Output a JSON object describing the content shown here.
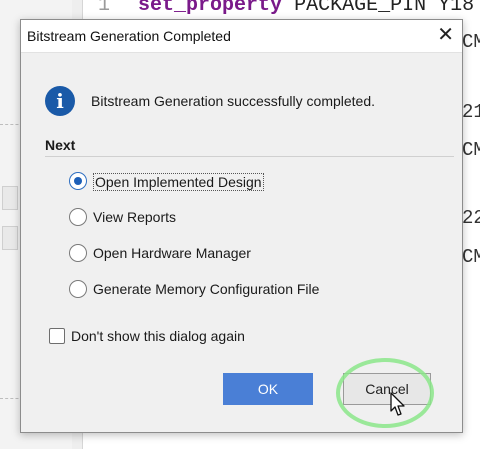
{
  "background": {
    "line_number": "1",
    "code_keyword": "set_property",
    "code_rest": " PACKAGE_PIN Y18",
    "fragments": [
      "CM",
      "21",
      "CM",
      "22",
      "CM"
    ]
  },
  "dialog": {
    "title": "Bitstream Generation Completed",
    "close_glyph": "✕",
    "info_glyph": "i",
    "message": "Bitstream Generation successfully completed.",
    "section_label": "Next",
    "options": [
      {
        "label": "Open Implemented Design",
        "selected": true
      },
      {
        "label": "View Reports",
        "selected": false
      },
      {
        "label": "Open Hardware Manager",
        "selected": false
      },
      {
        "label": "Generate Memory Configuration File",
        "selected": false
      }
    ],
    "dont_show_label": "Don't show this dialog again",
    "dont_show_checked": false,
    "ok_label": "OK",
    "cancel_label": "Cancel"
  },
  "colors": {
    "ok_button": "#4a7fd6",
    "info_icon": "#1a5aa8",
    "cursor_highlight": "#8be68a",
    "code_keyword": "#7a1a8a"
  },
  "icons": [
    "info-icon",
    "close-icon",
    "mouse-pointer-icon"
  ]
}
